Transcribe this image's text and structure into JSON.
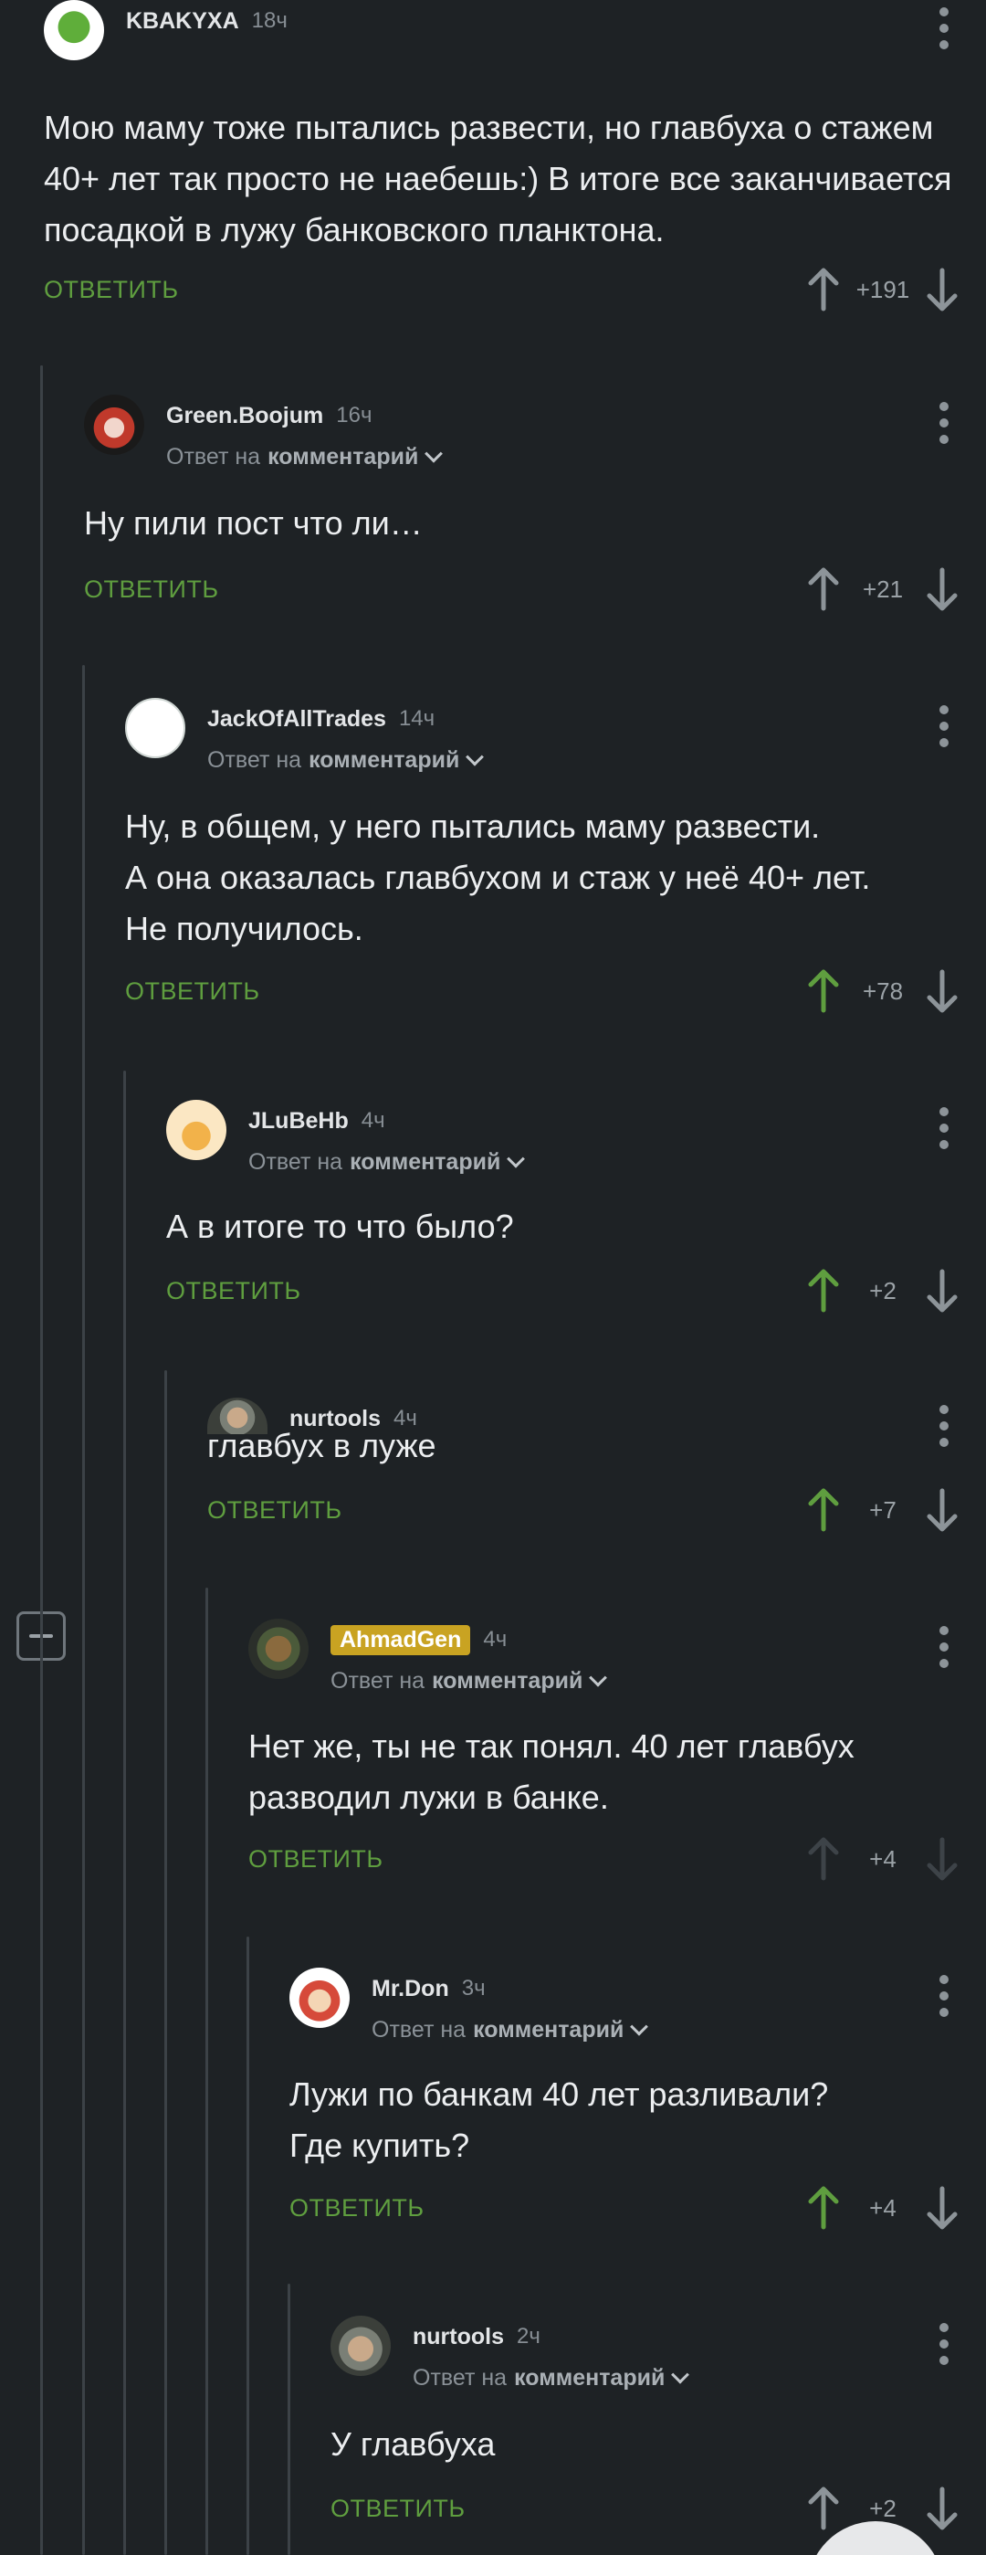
{
  "reply_label": "ОТВЕТИТЬ",
  "reply_to_prefix": "Ответ на",
  "reply_to_target": "комментарий",
  "colors": {
    "background": "#1e2225",
    "reply_green": "#5f9e3f",
    "upvoted_green": "#5f9e3f",
    "arrow_grey": "#8d9499",
    "badge_gold": "#c9a322"
  },
  "comments": [
    {
      "username": "KBAKYXA",
      "time": "18ч",
      "text": "Мою маму тоже пытались развести, но главбуха о стажем 40+ лет так просто не наебешь:) В итоге все заканчивается посадкой в лужу банковского планктона.",
      "rating": "+191",
      "avatar_icon": "frog-avatar-icon"
    },
    {
      "username": "Green.Boojum",
      "time": "16ч",
      "text": "Ну пили пост что ли…",
      "rating": "+21",
      "avatar_icon": "harley-avatar-icon"
    },
    {
      "username": "JackOfAllTrades",
      "time": "14ч",
      "text": "Ну, в общем, у него пытались маму развести.\nА она оказалась главбухом и стаж у неё 40+ лет.\nНе получилось.",
      "rating": "+78",
      "avatar_icon": "box-avatar-icon"
    },
    {
      "username": "JLuBeHb",
      "time": "4ч",
      "text": "А в итоге то что было?",
      "rating": "+2",
      "avatar_icon": "chef-avatar-icon"
    },
    {
      "username": "nurtools",
      "time": "4ч",
      "text": "главбух в луже",
      "rating": "+7",
      "avatar_icon": "oldman-avatar-icon"
    },
    {
      "username": "AhmadGen",
      "time": "4ч",
      "text": "Нет же, ты не так понял. 40 лет главбух разводил лужи в банке.",
      "rating": "+4",
      "avatar_icon": "cat-avatar-icon"
    },
    {
      "username": "Mr.Don",
      "time": "3ч",
      "text": "Лужи по банкам 40 лет разливали?\nГде купить?",
      "rating": "+4",
      "avatar_icon": "clown-avatar-icon"
    },
    {
      "username": "nurtools",
      "time": "2ч",
      "text": "У главбуха",
      "rating": "+2",
      "avatar_icon": "oldman-avatar-icon"
    }
  ]
}
